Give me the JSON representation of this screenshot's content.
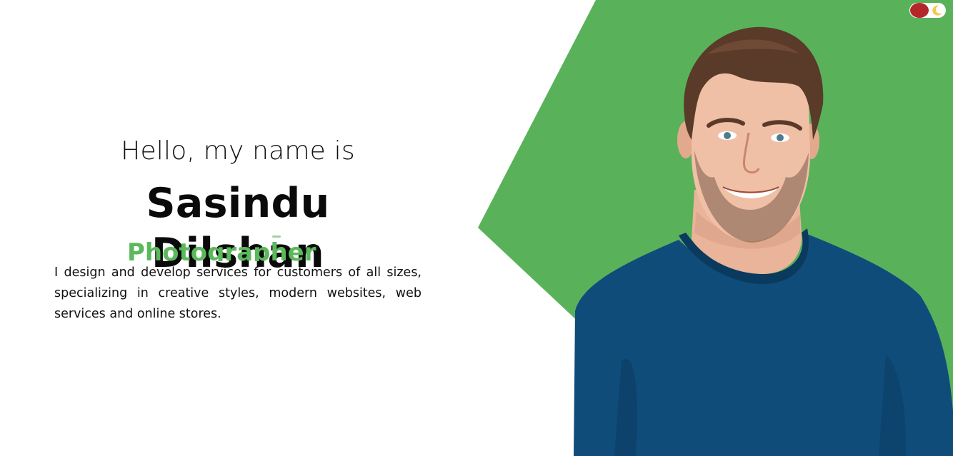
{
  "hero": {
    "greeting": "Hello, my name is",
    "name": "Sasindu Dilshan",
    "role": "Photographer",
    "description": "I design and develop services for customers of all sizes, specializing in creative styles, modern websites, web services and online stores."
  },
  "theme_toggle": {
    "state": "light",
    "knob_icon": "circle",
    "alt_icon": "moon-icon"
  },
  "colors": {
    "accent": "#5cb85c",
    "hero_panel": "#59b25a",
    "toggle_knob": "#b3262a",
    "moon": "#f2c94c",
    "text": "#111111",
    "background": "#ffffff"
  }
}
